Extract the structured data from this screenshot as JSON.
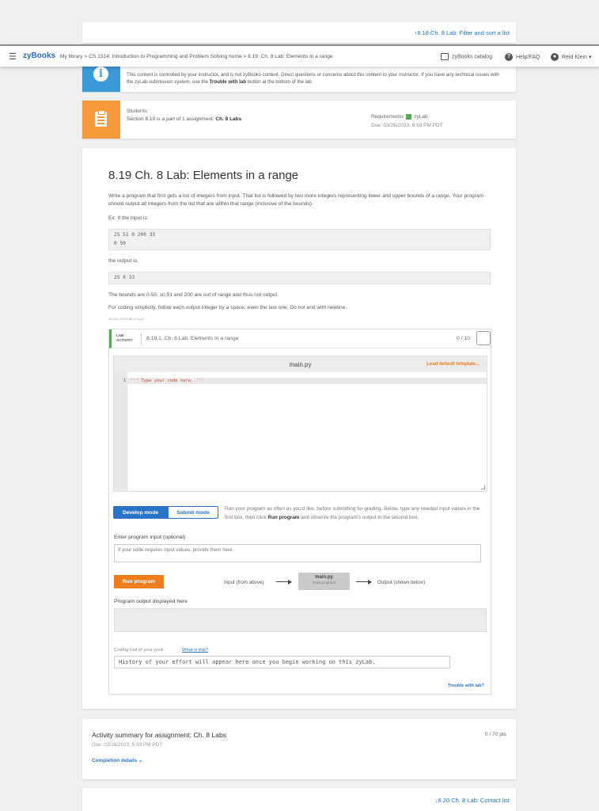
{
  "nav": {
    "prev_link": "8.18 Ch. 8 Lab: Filter and sort a list",
    "next_link": "8.20 Ch. 8 Lab: Contact list"
  },
  "topbar": {
    "logo": "zyBooks",
    "breadcrumb": "My library > CS 1314: Introduction to Programming and Problem Solving home > 8.19: Ch. 8 Lab: Elements in a range",
    "catalog": "zyBooks catalog",
    "help": "Help/FAQ",
    "user": "Reid Klein"
  },
  "info": {
    "text_before": "This content is controlled by your instructor, and is not zyBooks content. Direct questions or concerns about this content to your instructor. If you have any technical issues with the zyLab submission system, use the ",
    "trouble_bold": "Trouble with lab",
    "text_after": " button at the bottom of the lab."
  },
  "assignment": {
    "students_label": "Students:",
    "section_text": "Section 8.19 is a part of 1 assignment: ",
    "assignment_name": "Ch. 8 Labs",
    "requirements_label": "Requirements:",
    "requirement": "zyLab",
    "due": "Due: 03/26/2023, 9:59 PM PDT",
    "requirement_color": "#4caf50"
  },
  "content": {
    "title": "8.19 Ch. 8 Lab: Elements in a range",
    "intro": "Write a program that first gets a list of integers from input. That list is followed by two more integers representing lower and upper bounds of a range. Your program should output all integers from the list that are within that range (inclusive of the bounds).",
    "example_label": "Ex: If the input is:",
    "input_line1": "25 51 0 200 33",
    "input_line2": "0 50",
    "output_label": "the output is:",
    "output_line": "25 0 33",
    "explain": "The bounds are 0-50, so 51 and 200 are out of range and thus not output.",
    "simplicity": "For coding simplicity, follow each output integer by a space, even the last one. Do not end with newline.",
    "tiny_id": "462600.2150686.qx3zqy7"
  },
  "lab": {
    "tag_line1": "LAB",
    "tag_line2": "ACTIVITY",
    "title": "8.19.1: Ch. 8 Lab: Elements in a range",
    "score": "0 / 10",
    "filename": "main.py",
    "load_template": "Load default template...",
    "line_number": "1",
    "code": "''' Type your code here. '''",
    "develop_mode": "Develop mode",
    "submit_mode": "Submit mode",
    "mode_help_before": "Run your program as often as you'd like, before submitting for grading. Below, type any needed input values in the first box, then click ",
    "mode_help_bold": "Run program",
    "mode_help_after": " and observe the program's output in the second box.",
    "input_label": "Enter program input (optional)",
    "input_placeholder": "If your code requires input values, provide them here.",
    "run_button": "Run program",
    "flow_input": "Input (from above)",
    "flow_main": "main.py",
    "flow_main_sub": "(Your program)",
    "flow_output": "Output (shown below)",
    "output_label": "Program output displayed here",
    "trail_label": "Coding trail of your work",
    "trail_link": "What is this?",
    "trail_text": "History of your effort will appear here once you begin working on this zyLab.",
    "trouble": "Trouble with lab?"
  },
  "summary": {
    "title": "Activity summary for assignment: Ch. 8 Labs",
    "points": "0 / 70 pts",
    "due": "Due: 03/26/2023, 9:59 PM PDT",
    "details": "Completion details"
  },
  "colors": {
    "accent_blue": "#2a74c7",
    "accent_orange": "#f07d1b",
    "info_blue": "#3d9ad8",
    "assign_orange": "#f49a3b"
  }
}
